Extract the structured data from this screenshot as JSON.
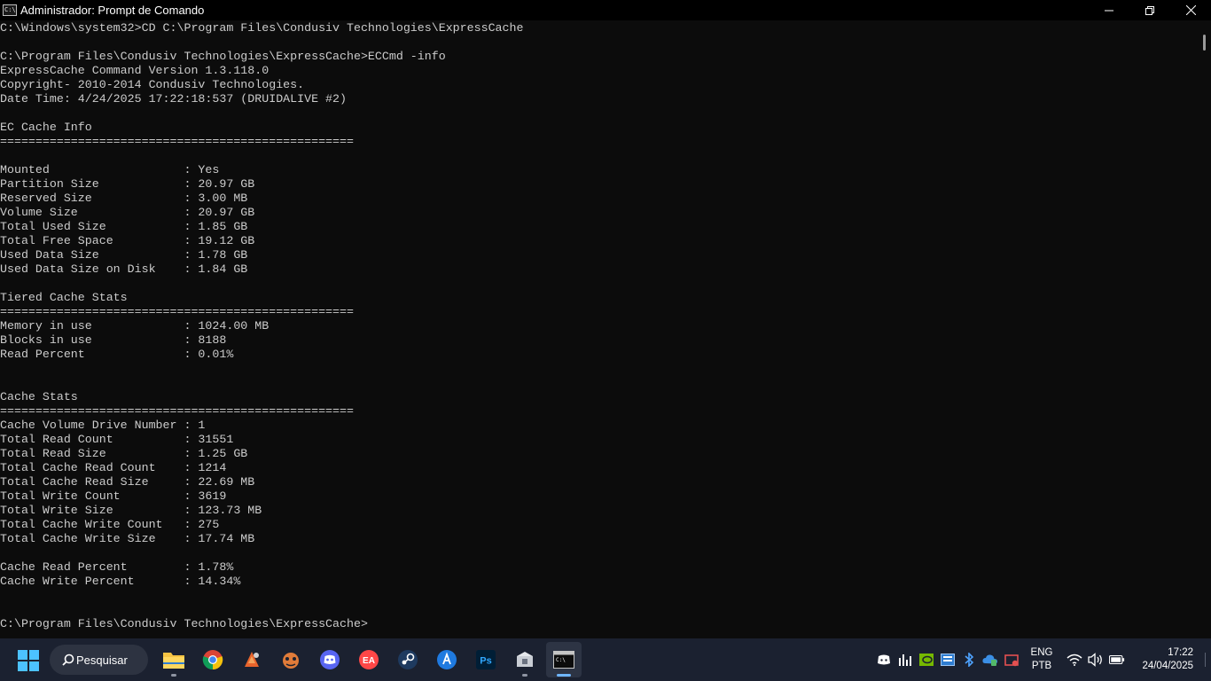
{
  "window": {
    "title": "Administrador: Prompt de Comando",
    "icon_text": "C:\\",
    "controls": [
      "minimize-icon",
      "restore-icon",
      "close-icon"
    ]
  },
  "console": {
    "lines": [
      "C:\\Windows\\system32>CD C:\\Program Files\\Condusiv Technologies\\ExpressCache",
      "",
      "C:\\Program Files\\Condusiv Technologies\\ExpressCache>ECCmd -info",
      "ExpressCache Command Version 1.3.118.0",
      "Copyright- 2010-2014 Condusiv Technologies.",
      "Date Time: 4/24/2025 17:22:18:537 (DRUIDALIVE #2)",
      "",
      "EC Cache Info",
      "==================================================",
      "",
      "Mounted                   : Yes",
      "Partition Size            : 20.97 GB",
      "Reserved Size             : 3.00 MB",
      "Volume Size               : 20.97 GB",
      "Total Used Size           : 1.85 GB",
      "Total Free Space          : 19.12 GB",
      "Used Data Size            : 1.78 GB",
      "Used Data Size on Disk    : 1.84 GB",
      "",
      "Tiered Cache Stats",
      "==================================================",
      "Memory in use             : 1024.00 MB",
      "Blocks in use             : 8188",
      "Read Percent              : 0.01%",
      "",
      "",
      "Cache Stats",
      "==================================================",
      "Cache Volume Drive Number : 1",
      "Total Read Count          : 31551",
      "Total Read Size           : 1.25 GB",
      "Total Cache Read Count    : 1214",
      "Total Cache Read Size     : 22.69 MB",
      "Total Write Count         : 3619",
      "Total Write Size          : 123.73 MB",
      "Total Cache Write Count   : 275",
      "Total Cache Write Size    : 17.74 MB",
      "",
      "Cache Read Percent        : 1.78%",
      "Cache Write Percent       : 14.34%",
      "",
      "",
      "C:\\Program Files\\Condusiv Technologies\\ExpressCache>"
    ]
  },
  "taskbar": {
    "search_label": "Pesquisar",
    "apps": [
      {
        "name": "file-explorer-icon",
        "active": false,
        "running": true
      },
      {
        "name": "chrome-icon",
        "active": false,
        "running": false
      },
      {
        "name": "app-orange-icon",
        "active": false,
        "running": false
      },
      {
        "name": "gamepad-icon",
        "active": false,
        "running": false
      },
      {
        "name": "discord-icon",
        "active": false,
        "running": false
      },
      {
        "name": "ea-icon",
        "active": false,
        "running": false
      },
      {
        "name": "steam-icon",
        "active": false,
        "running": false
      },
      {
        "name": "app-blue-icon",
        "active": false,
        "running": false
      },
      {
        "name": "photoshop-icon",
        "active": false,
        "running": false
      },
      {
        "name": "installer-icon",
        "active": false,
        "running": true
      },
      {
        "name": "terminal-icon",
        "active": true,
        "running": true
      }
    ],
    "tray": {
      "language": "ENG",
      "layout": "PTB",
      "time": "17:22",
      "date": "24/04/2025"
    }
  },
  "colors": {
    "console_bg": "#0c0c0c",
    "console_text": "#cccccc",
    "taskbar_bg": "#1b2130",
    "accent": "#6fb6ff"
  }
}
